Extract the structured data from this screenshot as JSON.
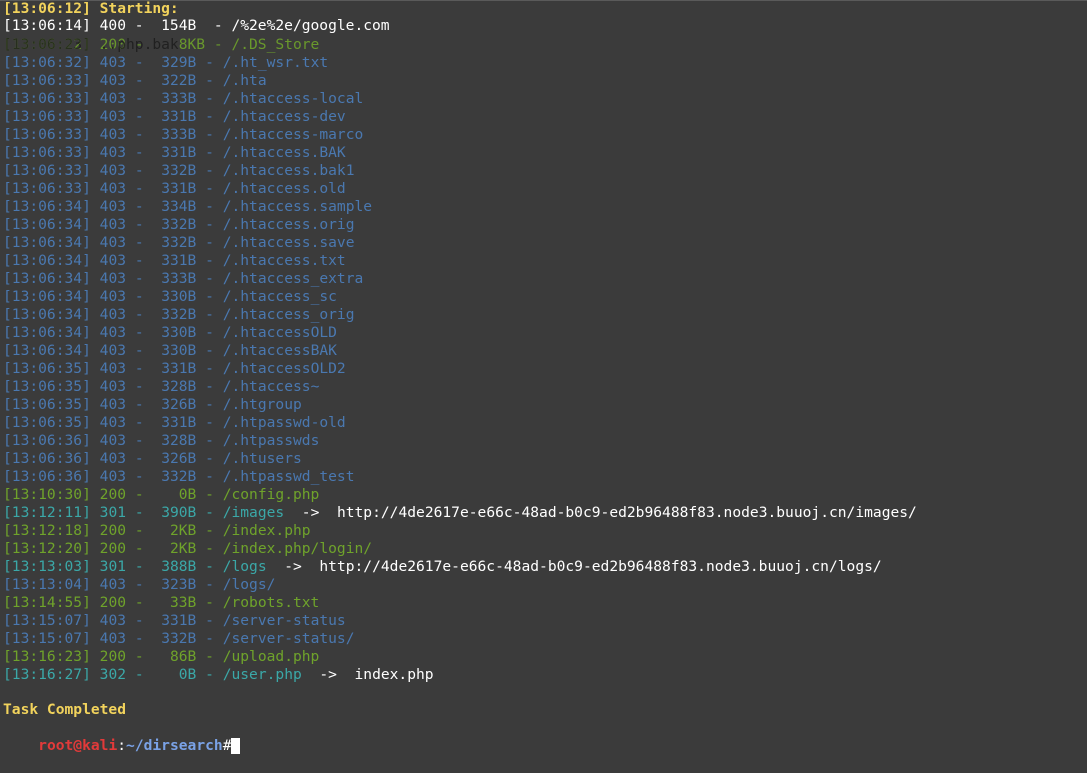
{
  "terminal": {
    "starting_label": "[13:06:12] Starting:",
    "overlay_lines": [
      "[13:06:14] 400 -  154B  - /%2e%2e/google.com",
      "[13:06:22] 200 -    8KB - /.DS_Store",
      "[13:06:23] ..php.bak"
    ],
    "entries": [
      {
        "time": "[13:06:32]",
        "code": "403",
        "size": "329B",
        "path": "/.ht_wsr.txt",
        "color": "blue"
      },
      {
        "time": "[13:06:33]",
        "code": "403",
        "size": "322B",
        "path": "/.hta",
        "color": "blue"
      },
      {
        "time": "[13:06:33]",
        "code": "403",
        "size": "333B",
        "path": "/.htaccess-local",
        "color": "blue"
      },
      {
        "time": "[13:06:33]",
        "code": "403",
        "size": "331B",
        "path": "/.htaccess-dev",
        "color": "blue"
      },
      {
        "time": "[13:06:33]",
        "code": "403",
        "size": "333B",
        "path": "/.htaccess-marco",
        "color": "blue"
      },
      {
        "time": "[13:06:33]",
        "code": "403",
        "size": "331B",
        "path": "/.htaccess.BAK",
        "color": "blue"
      },
      {
        "time": "[13:06:33]",
        "code": "403",
        "size": "332B",
        "path": "/.htaccess.bak1",
        "color": "blue"
      },
      {
        "time": "[13:06:33]",
        "code": "403",
        "size": "331B",
        "path": "/.htaccess.old",
        "color": "blue"
      },
      {
        "time": "[13:06:34]",
        "code": "403",
        "size": "334B",
        "path": "/.htaccess.sample",
        "color": "blue"
      },
      {
        "time": "[13:06:34]",
        "code": "403",
        "size": "332B",
        "path": "/.htaccess.orig",
        "color": "blue"
      },
      {
        "time": "[13:06:34]",
        "code": "403",
        "size": "332B",
        "path": "/.htaccess.save",
        "color": "blue"
      },
      {
        "time": "[13:06:34]",
        "code": "403",
        "size": "331B",
        "path": "/.htaccess.txt",
        "color": "blue"
      },
      {
        "time": "[13:06:34]",
        "code": "403",
        "size": "333B",
        "path": "/.htaccess_extra",
        "color": "blue"
      },
      {
        "time": "[13:06:34]",
        "code": "403",
        "size": "330B",
        "path": "/.htaccess_sc",
        "color": "blue"
      },
      {
        "time": "[13:06:34]",
        "code": "403",
        "size": "332B",
        "path": "/.htaccess_orig",
        "color": "blue"
      },
      {
        "time": "[13:06:34]",
        "code": "403",
        "size": "330B",
        "path": "/.htaccessOLD",
        "color": "blue"
      },
      {
        "time": "[13:06:34]",
        "code": "403",
        "size": "330B",
        "path": "/.htaccessBAK",
        "color": "blue"
      },
      {
        "time": "[13:06:35]",
        "code": "403",
        "size": "331B",
        "path": "/.htaccessOLD2",
        "color": "blue"
      },
      {
        "time": "[13:06:35]",
        "code": "403",
        "size": "328B",
        "path": "/.htaccess~",
        "color": "blue"
      },
      {
        "time": "[13:06:35]",
        "code": "403",
        "size": "326B",
        "path": "/.htgroup",
        "color": "blue"
      },
      {
        "time": "[13:06:35]",
        "code": "403",
        "size": "331B",
        "path": "/.htpasswd-old",
        "color": "blue"
      },
      {
        "time": "[13:06:36]",
        "code": "403",
        "size": "328B",
        "path": "/.htpasswds",
        "color": "blue"
      },
      {
        "time": "[13:06:36]",
        "code": "403",
        "size": "326B",
        "path": "/.htusers",
        "color": "blue"
      },
      {
        "time": "[13:06:36]",
        "code": "403",
        "size": "332B",
        "path": "/.htpasswd_test",
        "color": "blue"
      },
      {
        "time": "[13:10:30]",
        "code": "200",
        "size": "0B",
        "path": "/config.php",
        "color": "green"
      },
      {
        "time": "[13:12:11]",
        "code": "301",
        "size": "390B",
        "path": "/images",
        "color": "cyan",
        "redirect": "http://4de2617e-e66c-48ad-b0c9-ed2b96488f83.node3.buuoj.cn/images/"
      },
      {
        "time": "[13:12:18]",
        "code": "200",
        "size": "2KB",
        "path": "/index.php",
        "color": "green"
      },
      {
        "time": "[13:12:20]",
        "code": "200",
        "size": "2KB",
        "path": "/index.php/login/",
        "color": "green"
      },
      {
        "time": "[13:13:03]",
        "code": "301",
        "size": "388B",
        "path": "/logs",
        "color": "cyan",
        "redirect": "http://4de2617e-e66c-48ad-b0c9-ed2b96488f83.node3.buuoj.cn/logs/"
      },
      {
        "time": "[13:13:04]",
        "code": "403",
        "size": "323B",
        "path": "/logs/",
        "color": "blue"
      },
      {
        "time": "[13:14:55]",
        "code": "200",
        "size": "33B",
        "path": "/robots.txt",
        "color": "green"
      },
      {
        "time": "[13:15:07]",
        "code": "403",
        "size": "331B",
        "path": "/server-status",
        "color": "blue"
      },
      {
        "time": "[13:15:07]",
        "code": "403",
        "size": "332B",
        "path": "/server-status/",
        "color": "blue"
      },
      {
        "time": "[13:16:23]",
        "code": "200",
        "size": "86B",
        "path": "/upload.php",
        "color": "green"
      },
      {
        "time": "[13:16:27]",
        "code": "302",
        "size": "0B",
        "path": "/user.php",
        "color": "cyan",
        "redirect": "index.php"
      }
    ],
    "arrow": "->",
    "task_completed": "Task Completed",
    "prompt": {
      "user_host": "root@kali",
      "separator": ":",
      "path": "~/dirsearch",
      "symbol": "#"
    }
  }
}
